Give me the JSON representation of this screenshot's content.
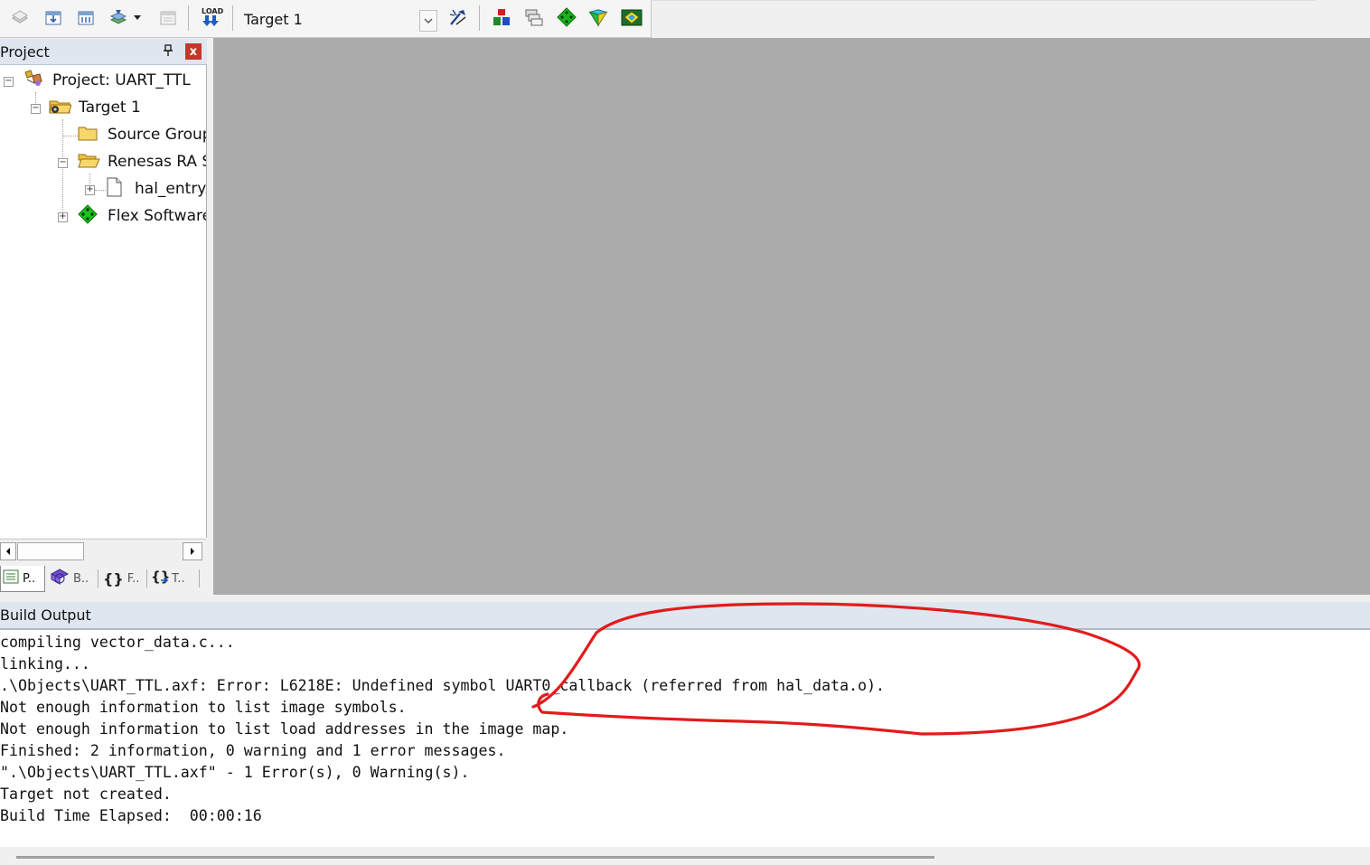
{
  "toolbar": {
    "target_value": "Target 1",
    "buttons": [
      {
        "name": "translate-icon"
      },
      {
        "name": "build-icon"
      },
      {
        "name": "rebuild-icon"
      },
      {
        "name": "batch-build-icon"
      },
      {
        "name": "stop-build-icon"
      },
      {
        "name": "download-icon"
      },
      {
        "name": "options-for-target-icon"
      },
      {
        "name": "manage-project-items-icon"
      },
      {
        "name": "select-packs-icon"
      },
      {
        "name": "manage-rte-icon"
      },
      {
        "name": "pack-installer-icon"
      },
      {
        "name": "ra-smart-configurator-icon"
      }
    ],
    "load_label": "LOAD"
  },
  "project_panel": {
    "title": "Project",
    "pin_glyph": "⌂",
    "close_glyph": "x",
    "tree": [
      {
        "label": "Project: UART_TTL",
        "icon": "project-icon"
      },
      {
        "label": "Target 1",
        "icon": "target-folder-icon"
      },
      {
        "label": "Source Group",
        "icon": "folder-icon"
      },
      {
        "label": "Renesas RA Sı",
        "icon": "folder-open-icon"
      },
      {
        "label": "hal_entry.",
        "icon": "file-icon"
      },
      {
        "label": "Flex Software",
        "icon": "component-icon"
      }
    ],
    "tabs": [
      {
        "label": "P.."
      },
      {
        "label": "B.."
      },
      {
        "label": "F.."
      },
      {
        "label": "T.."
      }
    ]
  },
  "build_output": {
    "title": "Build Output",
    "lines": [
      "compiling vector_data.c...",
      "linking...",
      ".\\Objects\\UART_TTL.axf: Error: L6218E: Undefined symbol UART0_callback (referred from hal_data.o).",
      "Not enough information to list image symbols.",
      "Not enough information to list load addresses in the image map.",
      "Finished: 2 information, 0 warning and 1 error messages.",
      "\".\\Objects\\UART_TTL.axf\" - 1 Error(s), 0 Warning(s).",
      "Target not created.",
      "Build Time Elapsed:  00:00:16"
    ]
  },
  "colors": {
    "editor_background": "#ababab",
    "panel_header": "#dfe6f0",
    "annotation": "#e31b1b",
    "close_button": "#c0392b"
  }
}
